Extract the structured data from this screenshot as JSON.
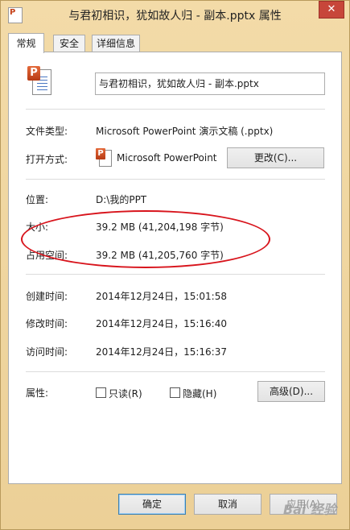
{
  "window": {
    "title": "与君初相识，犹如故人归 - 副本.pptx 属性",
    "close_glyph": "✕"
  },
  "tabs": [
    {
      "label": "常规"
    },
    {
      "label": "安全"
    },
    {
      "label": "详细信息"
    }
  ],
  "general": {
    "filename": "与君初相识，犹如故人归 - 副本.pptx",
    "file_type_label": "文件类型:",
    "file_type_value": "Microsoft PowerPoint 演示文稿 (.pptx)",
    "opens_with_label": "打开方式:",
    "opens_with_value": "Microsoft PowerPoint",
    "change_button": "更改(C)...",
    "location_label": "位置:",
    "location_value": "D:\\我的PPT",
    "size_label": "大小:",
    "size_value": "39.2 MB (41,204,198 字节)",
    "size_on_disk_label": "占用空间:",
    "size_on_disk_value": "39.2 MB (41,205,760 字节)",
    "created_label": "创建时间:",
    "created_value": "2014年12月24日，15:01:58",
    "modified_label": "修改时间:",
    "modified_value": "2014年12月24日，15:16:40",
    "accessed_label": "访问时间:",
    "accessed_value": "2014年12月24日，15:16:37",
    "attributes_label": "属性:",
    "readonly_label": "只读(R)",
    "hidden_label": "隐藏(H)",
    "advanced_button": "高级(D)..."
  },
  "footer": {
    "ok": "确定",
    "cancel": "取消",
    "apply": "应用(A)"
  },
  "colors": {
    "frame": "#f1d8a0",
    "annotation_oval": "#d8141c",
    "close": "#c7463a"
  },
  "watermark": "Bai 经验"
}
